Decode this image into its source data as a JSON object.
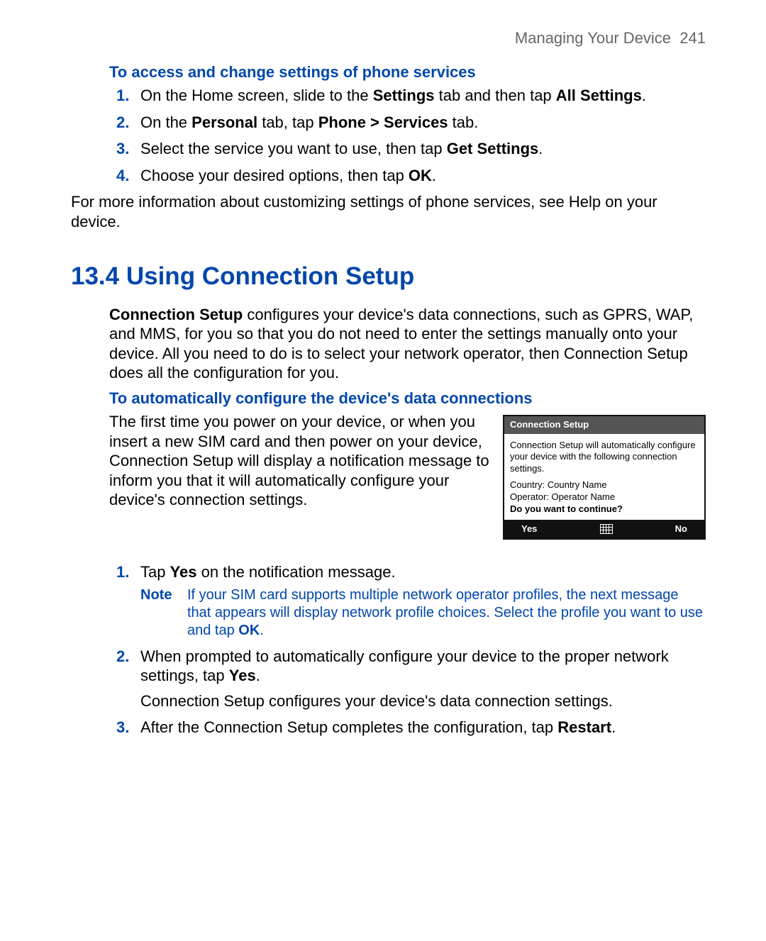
{
  "header": {
    "chapter": "Managing Your Device",
    "page": "241"
  },
  "sec1": {
    "heading": "To access and change settings of phone services",
    "steps": {
      "s1a": "On the Home screen, slide to the ",
      "s1b": "Settings",
      "s1c": " tab and then tap ",
      "s1d": "All Settings",
      "s1e": ".",
      "s2a": "On the ",
      "s2b": "Personal",
      "s2c": " tab, tap ",
      "s2d": "Phone > Services",
      "s2e": " tab.",
      "s3a": "Select the service you want to use, then tap ",
      "s3b": "Get Settings",
      "s3c": ".",
      "s4a": "Choose your desired options, then tap ",
      "s4b": "OK",
      "s4c": "."
    },
    "after": "For more information about customizing settings of phone services, see Help on your device."
  },
  "sec2": {
    "heading": "13.4  Using Connection Setup",
    "intro": {
      "a": "Connection Setup",
      "b": " configures your device's data connections, such as GPRS, WAP, and MMS, for you so that you do not need to enter the settings manually onto your device. All you need to do is to select your network operator, then Connection Setup does all the configuration for you."
    },
    "subheading": "To automatically configure the device's data connections",
    "wraptext": "The first time you power on your device, or when you insert a new SIM card and then power on your device, Connection Setup will display a notification message to inform you that it will automatically configure your device's connection settings.",
    "dialog": {
      "title": "Connection Setup",
      "l1": "Connection Setup will automatically configure your device with the following connection settings.",
      "l2": "Country: Country Name",
      "l3": "Operator: Operator Name",
      "l4": "Do you want to continue?",
      "yes": "Yes",
      "no": "No"
    },
    "steps": {
      "s1a": "Tap ",
      "s1b": "Yes",
      "s1c": " on the notification message.",
      "note_label": "Note",
      "note_a": "If your SIM card supports multiple network operator profiles, the next message that appears will display network profile choices. Select the profile you want to use and tap ",
      "note_b": "OK",
      "note_c": ".",
      "s2a": "When prompted to automatically configure your device to the proper network settings, tap ",
      "s2b": "Yes",
      "s2c": ".",
      "s2after": "Connection Setup configures your device's data connection settings.",
      "s3a": "After the Connection Setup completes the configuration, tap ",
      "s3b": "Restart",
      "s3c": "."
    }
  },
  "nums": {
    "n1": "1.",
    "n2": "2.",
    "n3": "3.",
    "n4": "4."
  }
}
